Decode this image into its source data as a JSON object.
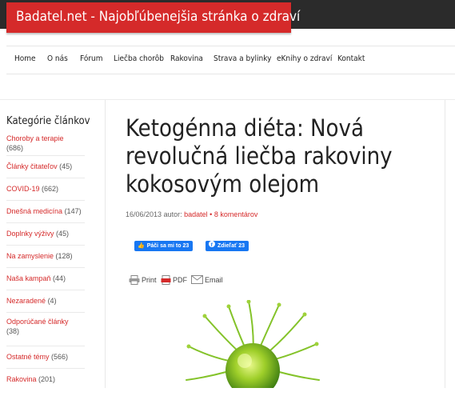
{
  "site": {
    "title": "Badatel.net - Najobľúbenejšia stránka o zdraví"
  },
  "nav": {
    "items": [
      "Home",
      "O nás",
      "Fórum",
      "Liečba chorôb",
      "Rakovina",
      "Strava a bylinky",
      "eKnihy o zdraví",
      "Kontakt"
    ]
  },
  "sidebar": {
    "title": "Kategórie článkov",
    "categories": [
      {
        "label": "Choroby a terapie",
        "count": "(686)"
      },
      {
        "label": "Články čitateľov",
        "count": "(45)"
      },
      {
        "label": "COVID-19",
        "count": "(662)"
      },
      {
        "label": "Dnešná medicína",
        "count": "(147)"
      },
      {
        "label": "Doplnky výživy",
        "count": "(45)"
      },
      {
        "label": "Na zamyslenie",
        "count": "(128)"
      },
      {
        "label": "Naša kampaň",
        "count": "(44)"
      },
      {
        "label": "Nezaradené",
        "count": "(4)"
      },
      {
        "label": "Odporúčané články",
        "count": "(38)"
      },
      {
        "label": "Ostatné témy",
        "count": "(566)"
      },
      {
        "label": "Rakovina",
        "count": "(201)"
      }
    ]
  },
  "article": {
    "title": "Ketogénna diéta: Nová revolučná liečba rakoviny kokosovým olejom",
    "date": "16/06/2013",
    "author_prefix": "autor:",
    "author": "badatel",
    "separator": "•",
    "comments": "8 komentárov"
  },
  "social": {
    "like_label": "Páči sa mi to 23",
    "share_label": "Zdieľať 23"
  },
  "share_tools": {
    "print": "Print",
    "pdf": "PDF",
    "email": "Email"
  },
  "colors": {
    "accent": "#d52a2a",
    "facebook": "#1877f2",
    "topbar": "#2b2b2b"
  }
}
